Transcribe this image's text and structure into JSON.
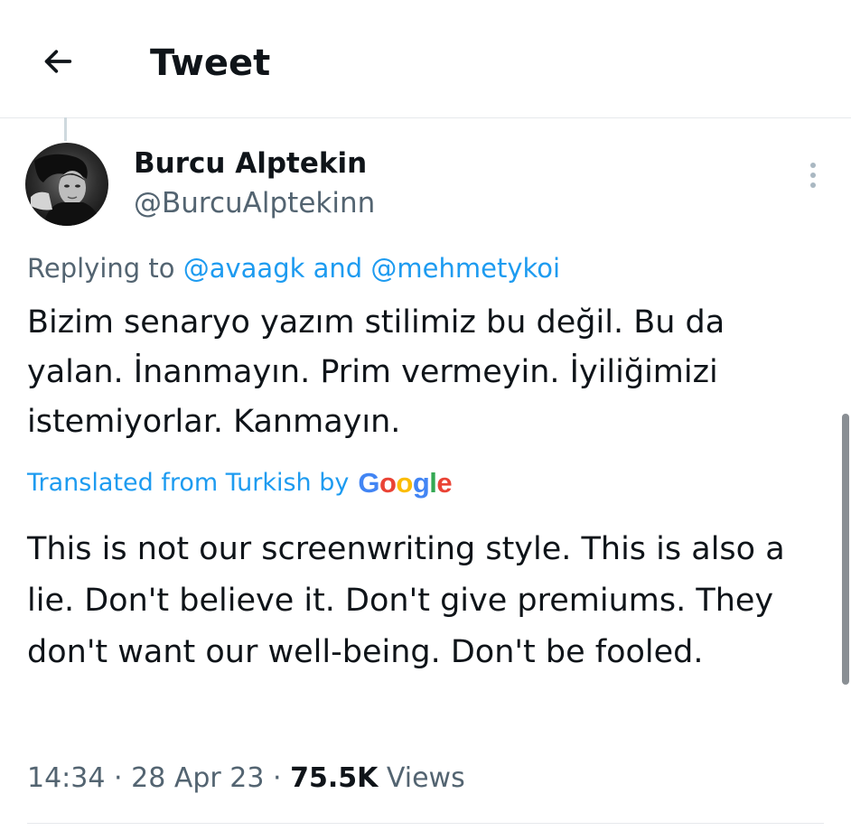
{
  "header": {
    "title": "Tweet",
    "back_icon": "arrow-left-icon"
  },
  "tweet": {
    "author_name": "Burcu Alptekin",
    "author_handle": "@BurcuAlptekinn",
    "more_icon": "more-vertical-icon",
    "replying_prefix": "Replying to",
    "mention_1": "@avaagk",
    "mention_joiner": "and",
    "mention_2": "@mehmetykoi",
    "text": "Bizim senaryo yazım stilimiz bu değil. Bu da yalan. İnanmayın. Prim vermeyin. İyiliğimizi istemiyorlar. Kanmayın.",
    "translated_label": "Translated from Turkish by",
    "google_logo_letters": [
      "G",
      "o",
      "o",
      "g",
      "l",
      "e"
    ],
    "google_logo_colors": [
      "#4285F4",
      "#EA4335",
      "#FBBC05",
      "#4285F4",
      "#34A853",
      "#EA4335"
    ],
    "translation": "This is not our screenwriting style. This is also a lie. Don't believe it. Don't give premiums. They don't want our well-being. Don't be fooled.",
    "time": "14:34",
    "separator": "·",
    "date": "28 Apr 23",
    "views_count": "75.5K",
    "views_label": "Views"
  },
  "colors": {
    "accent": "#1d9bf0",
    "text_primary": "#0f1419",
    "text_secondary": "#536471"
  }
}
